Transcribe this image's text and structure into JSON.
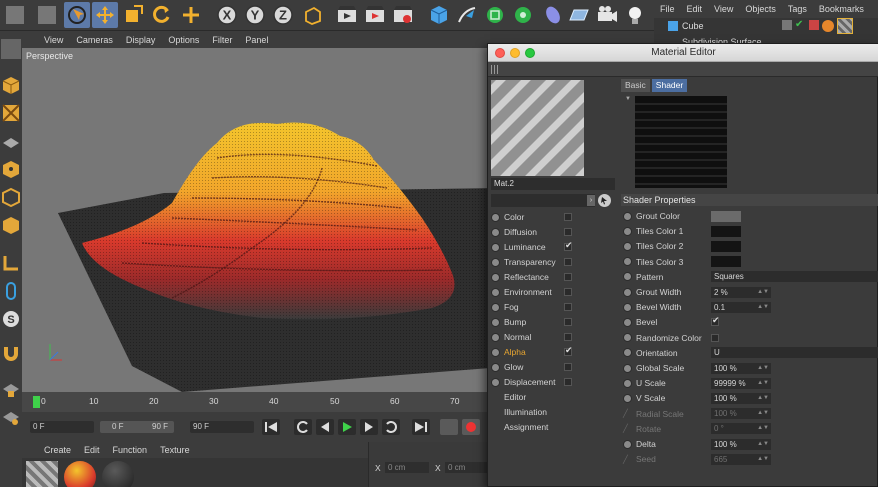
{
  "obj_menu": [
    "File",
    "Edit",
    "View",
    "Objects",
    "Tags",
    "Bookmarks"
  ],
  "obj_items": [
    "Cube",
    "Subdivision Surface"
  ],
  "viewport": {
    "menu": [
      "View",
      "Cameras",
      "Display",
      "Options",
      "Filter",
      "Panel"
    ],
    "label": "Perspective"
  },
  "timeline": {
    "ticks": [
      "0",
      "10",
      "20",
      "30",
      "40",
      "50",
      "60",
      "70"
    ]
  },
  "playback": {
    "start": "0 F",
    "cur_start": "0 F",
    "cur_end": "90 F",
    "end": "90 F"
  },
  "material_panel": {
    "menu": [
      "Create",
      "Edit",
      "Function",
      "Texture"
    ]
  },
  "coords": {
    "x1": "X",
    "x1v": "0 cm",
    "x2": "X",
    "x2v": "0 cm"
  },
  "editor": {
    "title": "Material Editor",
    "material_name": "Mat.2",
    "tabs": [
      "Basic",
      "Shader"
    ],
    "channels": [
      {
        "label": "Color",
        "checked": false,
        "active": false
      },
      {
        "label": "Diffusion",
        "checked": false,
        "active": false
      },
      {
        "label": "Luminance",
        "checked": true,
        "active": false
      },
      {
        "label": "Transparency",
        "checked": false,
        "active": false
      },
      {
        "label": "Reflectance",
        "checked": false,
        "active": false
      },
      {
        "label": "Environment",
        "checked": false,
        "active": false
      },
      {
        "label": "Fog",
        "checked": false,
        "active": false
      },
      {
        "label": "Bump",
        "checked": false,
        "active": false
      },
      {
        "label": "Normal",
        "checked": false,
        "active": false
      },
      {
        "label": "Alpha",
        "checked": true,
        "active": true
      },
      {
        "label": "Glow",
        "checked": false,
        "active": false
      },
      {
        "label": "Displacement",
        "checked": false,
        "active": false
      }
    ],
    "sub_items": [
      "Editor",
      "Illumination",
      "Assignment"
    ],
    "shader_properties": {
      "header": "Shader Properties",
      "rows": [
        {
          "label": "Grout Color",
          "type": "swatch",
          "color": "#6b6b6b"
        },
        {
          "label": "Tiles Color 1",
          "type": "swatch",
          "color": "#141414"
        },
        {
          "label": "Tiles Color 2",
          "type": "swatch",
          "color": "#141414"
        },
        {
          "label": "Tiles Color 3",
          "type": "swatch",
          "color": "#141414"
        },
        {
          "label": "Pattern",
          "type": "dropdown",
          "value": "Squares"
        },
        {
          "label": "Grout Width",
          "type": "number",
          "value": "2 %"
        },
        {
          "label": "Bevel Width",
          "type": "number",
          "value": "0.1"
        },
        {
          "label": "Bevel",
          "type": "check",
          "checked": true
        },
        {
          "label": "Randomize Color",
          "type": "check",
          "checked": false
        },
        {
          "label": "Orientation",
          "type": "dropdown",
          "value": "U"
        },
        {
          "label": "Global Scale",
          "type": "number",
          "value": "100 %"
        },
        {
          "label": "U Scale",
          "type": "number",
          "value": "99999 %"
        },
        {
          "label": "V Scale",
          "type": "number",
          "value": "100 %"
        },
        {
          "label": "Radial Scale",
          "type": "number",
          "value": "100 %",
          "dim": true
        },
        {
          "label": "Rotate",
          "type": "number",
          "value": "0 °",
          "dim": true
        },
        {
          "label": "Delta",
          "type": "number",
          "value": "100 %"
        },
        {
          "label": "Seed",
          "type": "number",
          "value": "665",
          "dim": true
        }
      ]
    }
  },
  "colors": {
    "accent": "#5d7aa8",
    "tab_active": "#4c6ea1",
    "active_channel": "#e7a531"
  }
}
